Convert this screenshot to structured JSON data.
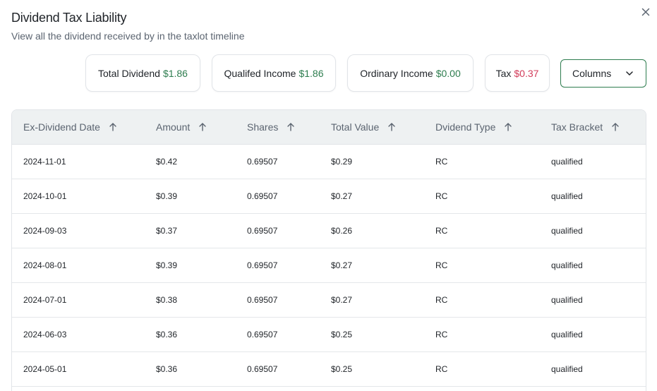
{
  "dialog": {
    "title": "Dividend Tax Liability",
    "subtitle": "View all the dividend received by in the taxlot timeline",
    "close_icon": "close-icon"
  },
  "summary": {
    "total_dividend": {
      "label": "Total Dividend",
      "value": "$1.86",
      "color": "#2e7d4f"
    },
    "qualified_income": {
      "label": "Qualifed Income",
      "value": "$1.86",
      "color": "#2e7d4f"
    },
    "ordinary_income": {
      "label": "Ordinary Income",
      "value": "$0.00",
      "color": "#2e7d4f"
    },
    "tax": {
      "label": "Tax",
      "value": "$0.37",
      "color": "#d23c5a"
    }
  },
  "columns_button": {
    "label": "Columns",
    "icon": "chevron-down-icon"
  },
  "table": {
    "headers": [
      "Ex-Dividend Date",
      "Amount",
      "Shares",
      "Total Value",
      "Dvidend Type",
      "Tax Bracket"
    ],
    "sort_icon": "arrow-up-icon",
    "rows": [
      [
        "2024-11-01",
        "$0.42",
        "0.69507",
        "$0.29",
        "RC",
        "qualified"
      ],
      [
        "2024-10-01",
        "$0.39",
        "0.69507",
        "$0.27",
        "RC",
        "qualified"
      ],
      [
        "2024-09-03",
        "$0.37",
        "0.69507",
        "$0.26",
        "RC",
        "qualified"
      ],
      [
        "2024-08-01",
        "$0.39",
        "0.69507",
        "$0.27",
        "RC",
        "qualified"
      ],
      [
        "2024-07-01",
        "$0.38",
        "0.69507",
        "$0.27",
        "RC",
        "qualified"
      ],
      [
        "2024-06-03",
        "$0.36",
        "0.69507",
        "$0.25",
        "RC",
        "qualified"
      ],
      [
        "2024-05-01",
        "$0.36",
        "0.69507",
        "$0.25",
        "RC",
        "qualified"
      ]
    ]
  }
}
